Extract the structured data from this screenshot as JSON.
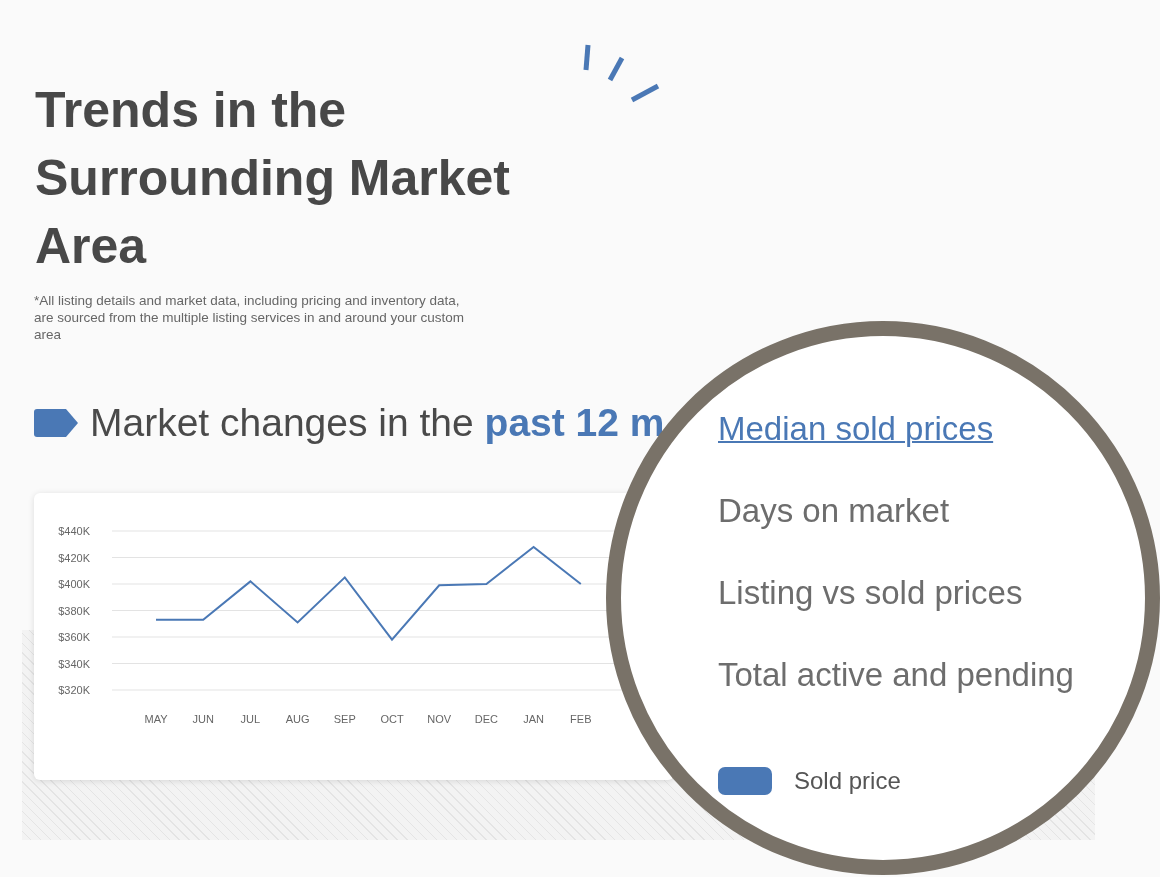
{
  "title": "Trends in the Surrounding Market Area",
  "disclaimer": "*All listing details and market data, including pricing and inventory data, are sourced from the multiple listing services in and around your custom area",
  "section_heading": "Market changes in the **past 12 m**",
  "chart": {
    "chart_data": {
      "type": "line",
      "categories": [
        "MAY",
        "JUN",
        "JUL",
        "AUG",
        "SEP",
        "OCT",
        "NOV",
        "DEC",
        "JAN",
        "FEB"
      ],
      "grid": true,
      "series": [
        {
          "name": "Sold price",
          "color": "#4a78b5",
          "values": [
            373,
            373,
            402,
            371,
            405,
            358,
            399,
            400,
            428,
            400
          ]
        }
      ],
      "ylim": [
        320,
        440
      ],
      "yticks": [
        {
          "value": 320,
          "label": "$320K"
        },
        {
          "value": 340,
          "label": "$340K"
        },
        {
          "value": 360,
          "label": "$360K"
        },
        {
          "value": 380,
          "label": "$380K"
        },
        {
          "value": 400,
          "label": "$400K"
        },
        {
          "value": 420,
          "label": "$420K"
        },
        {
          "value": 440,
          "label": "$440K"
        }
      ]
    }
  },
  "magnifier": {
    "metrics": [
      {
        "label": "Median sold prices",
        "selected": true
      },
      {
        "label": "Days on market",
        "selected": false
      },
      {
        "label": "Listing vs sold prices",
        "selected": false
      },
      {
        "label": "Total active and pending",
        "selected": false
      }
    ]
  }
}
